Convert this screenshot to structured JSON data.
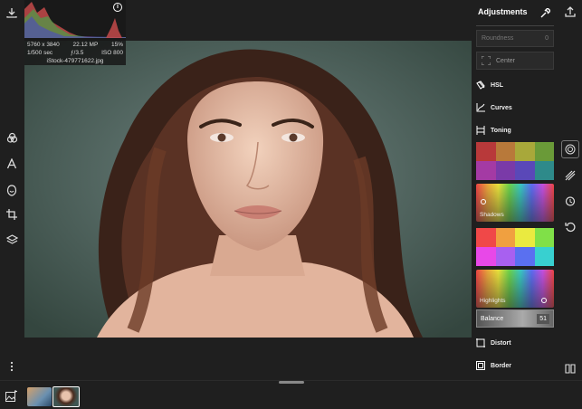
{
  "histogram": {
    "dimensions": "5760 x 3840",
    "megapixels": "22.12 MP",
    "percent": "15%",
    "shutter": "1/500 sec",
    "aperture": "ƒ/3.5",
    "iso": "ISO 800",
    "filename": "iStock-479771622.jpg"
  },
  "panel": {
    "title": "Adjustments",
    "roundness_label": "Roundness",
    "roundness_value": "0",
    "center_label": "Center",
    "tools": {
      "hsl": "HSL",
      "curves": "Curves",
      "toning": "Toning",
      "distort": "Distort",
      "border": "Border"
    },
    "shadows_label": "Shadows",
    "highlights_label": "Highlights",
    "balance_label": "Balance",
    "balance_value": "51"
  },
  "colors": {
    "shadow_swatches": [
      "#b8393a",
      "#b8793a",
      "#a8a83a",
      "#6a9a38",
      "#a43aa4",
      "#7a3aa8",
      "#5a48b8",
      "#2e8a8a"
    ],
    "highlight_swatches": [
      "#f04848",
      "#f0a040",
      "#eaea40",
      "#80e048",
      "#e848e8",
      "#a860f0",
      "#5a70f0",
      "#38d0d0"
    ],
    "accent": "#ffffff"
  },
  "icons": {
    "download": "download-icon",
    "share": "share-icon",
    "eyedropper": "eyedropper-icon",
    "info": "info-icon",
    "filters": "filters-icon",
    "text": "text-icon",
    "retouch": "retouch-icon",
    "crop": "crop-icon",
    "layers": "layers-icon",
    "more": "more-vertical-icon",
    "photos": "photos-icon",
    "compare": "compare-icon"
  }
}
